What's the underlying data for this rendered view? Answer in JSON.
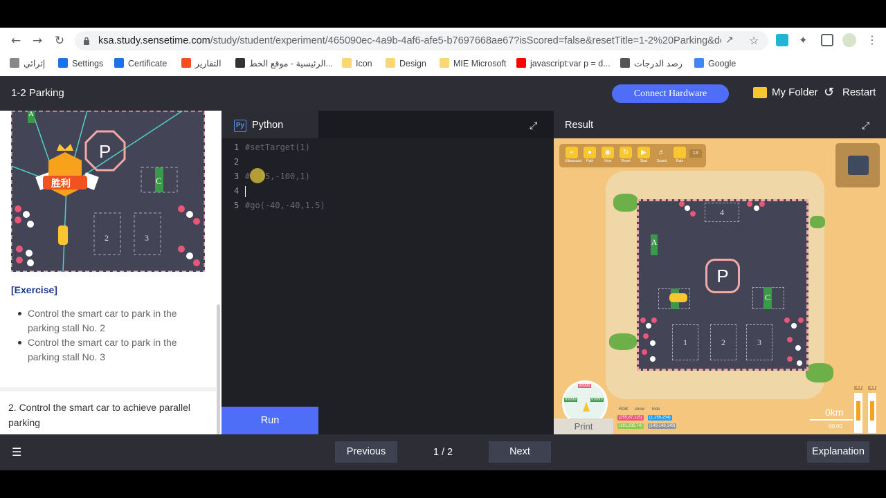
{
  "browser": {
    "url_host": "ksa.study.sensetime.com",
    "url_rest": "/study/student/experiment/465090ec-4a9b-4af6-afe5-b7697668ae67?isScored=false&resetTitle=1-2%20Parking&doc...",
    "bookmarks": [
      {
        "label": "إثرائي",
        "icon": "enrichment-icon",
        "color": "#888888"
      },
      {
        "label": "Settings",
        "icon": "gear-icon",
        "color": "#1a73e8"
      },
      {
        "label": "Certificate",
        "icon": "certificate-icon",
        "color": "#1a73e8"
      },
      {
        "label": "التقارير",
        "icon": "microsoft-icon",
        "color": "#f25022"
      },
      {
        "label": "الرئيسية - موقع الخط...",
        "icon": "site-icon",
        "color": "#333333"
      },
      {
        "label": "Icon",
        "icon": "folder-icon",
        "color": "#f8d775"
      },
      {
        "label": "Design",
        "icon": "folder-icon",
        "color": "#f8d775"
      },
      {
        "label": "MIE Microsoft",
        "icon": "folder-icon",
        "color": "#f8d775"
      },
      {
        "label": "javascript:var p = d...",
        "icon": "youtube-icon",
        "color": "#ff0000"
      },
      {
        "label": "رصد الدرجات",
        "icon": "globe-icon",
        "color": "#555555"
      },
      {
        "label": "Google",
        "icon": "google-icon",
        "color": "#4285f4"
      }
    ]
  },
  "header": {
    "title": "1-2 Parking",
    "connect_label": "Connect Hardware",
    "folder_label": "My Folder",
    "restart_label": "Restart"
  },
  "left": {
    "exercise_title": "[Exercise]",
    "bullets": [
      "Control the smart car to park in the parking stall No. 2",
      "Control the smart car to park in the parking stall No. 3"
    ],
    "item2": "2. Control the smart car to achieve parallel parking",
    "map_labels": {
      "a": "A",
      "c": "C",
      "p": "P",
      "s2": "2",
      "s3": "3",
      "victory": "胜利"
    }
  },
  "editor": {
    "tab_label": "Python",
    "lines": [
      {
        "n": "1",
        "code": "#setTarget(1)"
      },
      {
        "n": "2",
        "code": ""
      },
      {
        "n": "3",
        "code": "#  35,-100,1)"
      },
      {
        "n": "4",
        "code": ""
      },
      {
        "n": "5",
        "code": "#go(-40,-40,1.5)"
      }
    ],
    "run_label": "Run"
  },
  "result": {
    "title": "Result",
    "tools": [
      {
        "label": "Ultrasound",
        "icon": "ultrasound-icon"
      },
      {
        "label": "Path",
        "icon": "path-icon"
      },
      {
        "label": "View",
        "icon": "eye-icon"
      },
      {
        "label": "Reset",
        "icon": "reset-icon"
      },
      {
        "label": "Start",
        "icon": "play-icon"
      },
      {
        "label": "Sound",
        "icon": "mute-icon"
      },
      {
        "label": "Rate",
        "icon": "lightning-icon"
      }
    ],
    "rate": "1X",
    "stalls": {
      "s4": "4",
      "a": "A",
      "p": "P",
      "c": "C",
      "s1": "1",
      "s2": "2",
      "s3": "3"
    },
    "wheel_values": [
      "99999",
      "99999",
      "99999"
    ],
    "rgb_label": "RGB:",
    "show_label": "show",
    "hide_label": "hide",
    "rgb_vals": [
      "(255,87,115)",
      "(1,159,254)",
      "(181,235,74)",
      "(149,148,149)"
    ],
    "print_label": "Print",
    "distance": "0km",
    "time": "00:00",
    "meter_vals": [
      "-4.4",
      "-4.4"
    ]
  },
  "footer": {
    "previous_label": "Previous",
    "page_indicator": "1 / 2",
    "next_label": "Next",
    "explanation_label": "Explanation"
  }
}
